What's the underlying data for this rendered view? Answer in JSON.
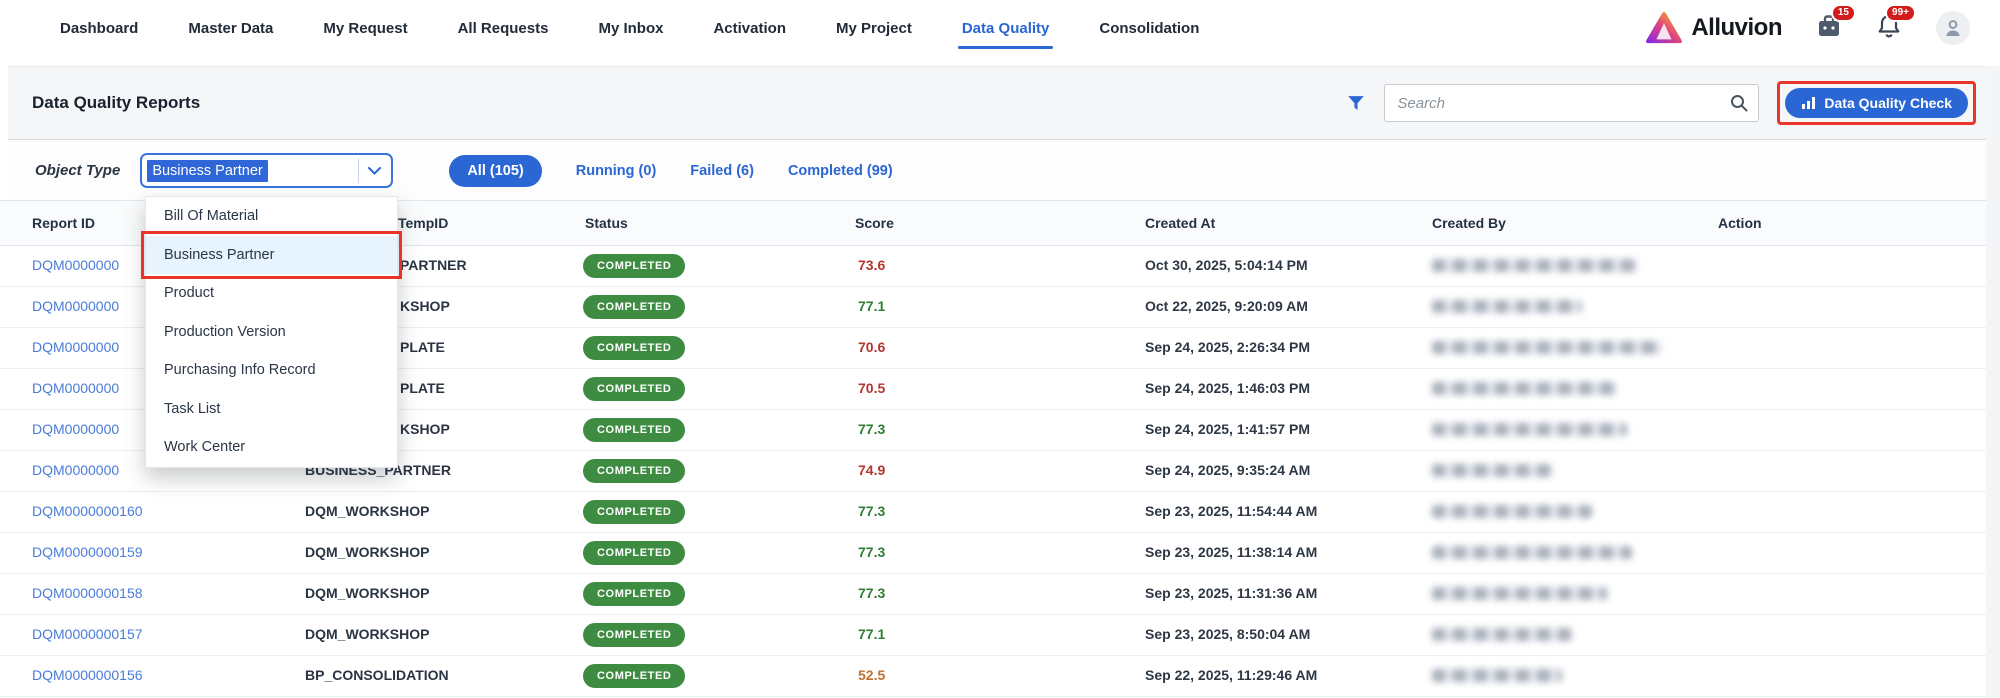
{
  "nav": {
    "items": [
      {
        "label": "Dashboard"
      },
      {
        "label": "Master Data"
      },
      {
        "label": "My Request"
      },
      {
        "label": "All Requests"
      },
      {
        "label": "My Inbox"
      },
      {
        "label": "Activation"
      },
      {
        "label": "My Project"
      },
      {
        "label": "Data Quality",
        "active": true
      },
      {
        "label": "Consolidation"
      }
    ],
    "brand": "Alluvion",
    "badges": {
      "briefcase": "15",
      "bell": "99+"
    }
  },
  "toolbar": {
    "title": "Data Quality Reports",
    "search_placeholder": "Search",
    "check_button": "Data Quality Check"
  },
  "filters": {
    "object_type_label": "Object Type",
    "object_type_value": "Business Partner",
    "tabs": [
      {
        "label": "All (105)",
        "active": true
      },
      {
        "label": "Running (0)",
        "active": false
      },
      {
        "label": "Failed (6)",
        "active": false
      },
      {
        "label": "Completed (99)",
        "active": false
      }
    ]
  },
  "dropdown": {
    "options": [
      "Bill Of Material",
      "Business Partner",
      "Product",
      "Production Version",
      "Purchasing Info Record",
      "Task List",
      "Work Center"
    ],
    "highlighted": "Business Partner"
  },
  "table": {
    "columns": [
      "Report ID",
      "TempID",
      "Status",
      "Score",
      "Created At",
      "Created By",
      "Action"
    ],
    "rows": [
      {
        "report_id": "DQM0000000",
        "tempid": "PARTNER",
        "tempid_occluded": true,
        "status": "COMPLETED",
        "score": "73.6",
        "score_color": "red",
        "created_at": "Oct 30, 2025, 5:04:14 PM",
        "created_by_redacted": true
      },
      {
        "report_id": "DQM0000000",
        "tempid": "KSHOP",
        "tempid_occluded": true,
        "status": "COMPLETED",
        "score": "77.1",
        "score_color": "green",
        "created_at": "Oct 22, 2025, 9:20:09 AM",
        "created_by_redacted": true
      },
      {
        "report_id": "DQM0000000",
        "tempid": "PLATE",
        "tempid_occluded": true,
        "status": "COMPLETED",
        "score": "70.6",
        "score_color": "red",
        "created_at": "Sep 24, 2025, 2:26:34 PM",
        "created_by_redacted": true
      },
      {
        "report_id": "DQM0000000",
        "tempid": "PLATE",
        "tempid_occluded": true,
        "status": "COMPLETED",
        "score": "70.5",
        "score_color": "red",
        "created_at": "Sep 24, 2025, 1:46:03 PM",
        "created_by_redacted": true
      },
      {
        "report_id": "DQM0000000",
        "tempid": "KSHOP",
        "tempid_occluded": true,
        "status": "COMPLETED",
        "score": "77.3",
        "score_color": "green",
        "created_at": "Sep 24, 2025, 1:41:57 PM",
        "created_by_redacted": true
      },
      {
        "report_id": "DQM0000000",
        "tempid": "BUSINESS_PARTNER",
        "tempid_occluded": false,
        "status": "COMPLETED",
        "score": "74.9",
        "score_color": "red",
        "created_at": "Sep 24, 2025, 9:35:24 AM",
        "created_by_redacted": true
      },
      {
        "report_id": "DQM0000000160",
        "tempid": "DQM_WORKSHOP",
        "tempid_occluded": false,
        "status": "COMPLETED",
        "score": "77.3",
        "score_color": "green",
        "created_at": "Sep 23, 2025, 11:54:44 AM",
        "created_by_redacted": true
      },
      {
        "report_id": "DQM0000000159",
        "tempid": "DQM_WORKSHOP",
        "tempid_occluded": false,
        "status": "COMPLETED",
        "score": "77.3",
        "score_color": "green",
        "created_at": "Sep 23, 2025, 11:38:14 AM",
        "created_by_redacted": true
      },
      {
        "report_id": "DQM0000000158",
        "tempid": "DQM_WORKSHOP",
        "tempid_occluded": false,
        "status": "COMPLETED",
        "score": "77.3",
        "score_color": "green",
        "created_at": "Sep 23, 2025, 11:31:36 AM",
        "created_by_redacted": true
      },
      {
        "report_id": "DQM0000000157",
        "tempid": "DQM_WORKSHOP",
        "tempid_occluded": false,
        "status": "COMPLETED",
        "score": "77.1",
        "score_color": "green",
        "created_at": "Sep 23, 2025, 8:50:04 AM",
        "created_by_redacted": true
      },
      {
        "report_id": "DQM0000000156",
        "tempid": "BP_CONSOLIDATION",
        "tempid_occluded": false,
        "status": "COMPLETED",
        "score": "52.5",
        "score_color": "orange",
        "created_at": "Sep 22, 2025, 11:29:46 AM",
        "created_by_redacted": true
      }
    ]
  },
  "colors": {
    "accent_blue": "#2a66d4",
    "link_blue": "#4a7cd6",
    "badge_green": "#3e8c42",
    "score_red": "#b5342e",
    "score_green": "#2f7d33",
    "score_orange": "#c2702e",
    "annotation_red": "#e8342a"
  }
}
